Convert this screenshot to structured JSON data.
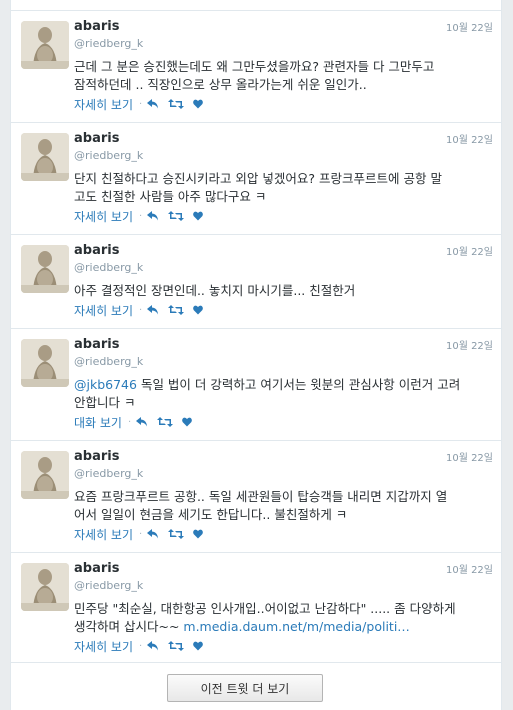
{
  "tweets": [
    {
      "name": "abaris",
      "handle": "@riedberg_k",
      "date": "10월 22일",
      "text_lines": [
        "근데 그 분은 승진했는데도 왜 그만두셨을까요? 관련자들 다 그만두고",
        "잠적하던데 .. 직장인으로 상무 올라가는게 쉬운 일인가.."
      ],
      "action_label": "자세히 보기"
    },
    {
      "name": "abaris",
      "handle": "@riedberg_k",
      "date": "10월 22일",
      "text_lines": [
        "단지 친절하다고 승진시키라고 외압 넣겠어요? 프랑크푸르트에 공항 말",
        "고도 친절한 사람들 아주 많다구요 ㅋ"
      ],
      "action_label": "자세히 보기"
    },
    {
      "name": "abaris",
      "handle": "@riedberg_k",
      "date": "10월 22일",
      "text_lines": [
        "아주 결정적인 장면인데.. 놓치지 마시기를... 친절한거"
      ],
      "action_label": "자세히 보기"
    },
    {
      "name": "abaris",
      "handle": "@riedberg_k",
      "date": "10월 22일",
      "mention": "@jkb6746",
      "text_lines": [
        " 독일 법이 더 강력하고 여기서는 윗분의 관심사항 이런거 고려",
        "안합니다 ㅋ"
      ],
      "action_label": "대화 보기"
    },
    {
      "name": "abaris",
      "handle": "@riedberg_k",
      "date": "10월 22일",
      "text_lines": [
        "요즘 프랑크푸르트 공항.. 독일 세관원들이 탑승객들 내리면 지갑까지 열",
        "어서 일일이 현금을 세기도 한답니다.. 불친절하게 ㅋ"
      ],
      "action_label": "자세히 보기"
    },
    {
      "name": "abaris",
      "handle": "@riedberg_k",
      "date": "10월 22일",
      "text_lines": [
        "민주당 \"최순실, 대한항공 인사개입..어이없고 난감하다\" ..... 좀 다양하게",
        "생각하며 삽시다~~ "
      ],
      "link": "m.media.daum.net/m/media/politi…",
      "action_label": "자세히 보기"
    }
  ],
  "load_more_label": "이전 트윗 더 보기",
  "icons": [
    "reply-icon",
    "retweet-icon",
    "like-icon"
  ],
  "colors": {
    "link": "#2b7bb9",
    "text": "#292f33",
    "muted": "#8899a6"
  }
}
